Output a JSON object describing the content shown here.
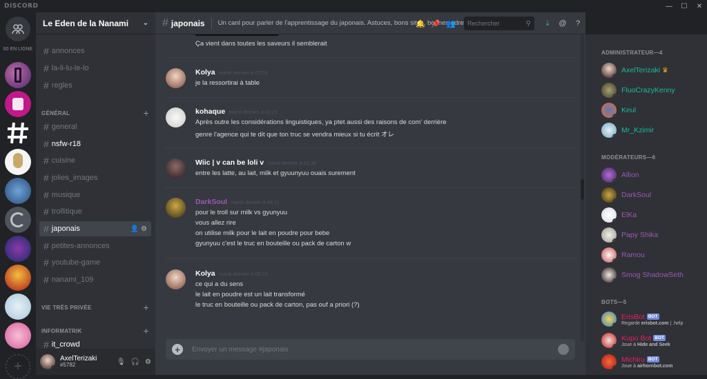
{
  "app": {
    "logo": "DISCORD",
    "win_minimize": "—",
    "win_maximize": "☐",
    "win_close": "✕"
  },
  "guilds": {
    "online_label": "60 EN LIGNE",
    "add_label": "+"
  },
  "server": {
    "name": "Le Eden de la Nanami",
    "chevron": "⌄"
  },
  "channels": [
    {
      "name": "annonces",
      "unread": false
    },
    {
      "name": "la-li-lu-le-lo",
      "unread": false
    },
    {
      "name": "regles",
      "unread": false
    }
  ],
  "categories": [
    {
      "label": "GÉNÉRAL",
      "plus": "+"
    },
    {
      "label": "VIE TRÈS PRIVÉE",
      "plus": "+"
    },
    {
      "label": "INFORMATRIK",
      "plus": "+"
    }
  ],
  "general_channels": [
    {
      "name": "general"
    },
    {
      "name": "nsfw-r18"
    },
    {
      "name": "cuisine"
    },
    {
      "name": "jolies_images"
    },
    {
      "name": "musique"
    },
    {
      "name": "trollitique"
    },
    {
      "name": "japonais"
    },
    {
      "name": "petites-annonces"
    },
    {
      "name": "youtube-game"
    },
    {
      "name": "nanami_109"
    }
  ],
  "info_channels": [
    {
      "name": "it_crowd"
    }
  ],
  "user": {
    "name": "AxelTerizaki",
    "tag": "#5782"
  },
  "header": {
    "channel": "japonais",
    "topic": "Un canl pour parler de l'apprentissage du japonais. Astuces, bons sites, bonnes adresses, ou appels à l...",
    "search_placeholder": "Rechercher"
  },
  "messages": {
    "top_line": "Ça vient dans toutes les saveurs il semblerait",
    "groups": [
      {
        "author": "Kolya",
        "time": "mardi dernier à 02:04",
        "color": "#ffffff",
        "lines": [
          "je la ressortirai à table"
        ]
      },
      {
        "author": "kohaque",
        "time": "mardi dernier à 02:21",
        "color": "#ffffff",
        "lines": [
          "Après outre les considérations linguistiques, ya ptet aussi des raisons de com' derrière",
          "genre l'agence qui te dit que ton truc se vendra mieux si tu écrit オレ"
        ]
      },
      {
        "author": "Wiic | v can be loli v",
        "time": "mardi dernier à 02:36",
        "color": "#ffffff",
        "lines": [
          "entre les latte, au lait, milk et gyuunyuu ouais surement"
        ]
      },
      {
        "author": "DarkSoul",
        "time": "mardi dernier à 08:11",
        "color": "#9b59b6",
        "lines": [
          "pour le troll sur milk vs gyunyuu",
          "vous allez rire",
          "on utilise milk pour le lait en poudre pour bebe",
          "gyunyuu c'est le truc en bouteille ou pack de carton w"
        ]
      },
      {
        "author": "Kolya",
        "time": "mardi dernier à 09:29",
        "color": "#ffffff",
        "lines": [
          "ce qui a du sens",
          "le lait en poudre est un lait transformé",
          "le truc en bouteille ou pack de carton, pas ouf a priori (?)"
        ]
      }
    ]
  },
  "composer": {
    "placeholder": "Envoyer un message #japonais"
  },
  "members": {
    "admin_label": "ADMINISTRATEUR—4",
    "mod_label": "MODÉRATEURS—6",
    "bots_label": "BOTS—5",
    "admins": [
      {
        "name": "AxelTerizaki",
        "color": "#1abc9c",
        "status": "#43b581",
        "crown": "♛"
      },
      {
        "name": "FluoCrazyKenny",
        "color": "#1abc9c",
        "status": "#faa61a"
      },
      {
        "name": "Keul",
        "color": "#1abc9c",
        "status": "#faa61a"
      },
      {
        "name": "Mr_Kzimir",
        "color": "#1abc9c",
        "status": "#faa61a"
      }
    ],
    "mods": [
      {
        "name": "Allion",
        "color": "#9b59b6",
        "status": "#faa61a"
      },
      {
        "name": "DarkSoul",
        "color": "#9b59b6",
        "status": "#43b581"
      },
      {
        "name": "ElKa",
        "color": "#9b59b6",
        "status": "#43b581"
      },
      {
        "name": "Papy Shika",
        "color": "#9b59b6",
        "status": "#faa61a"
      },
      {
        "name": "Ramou",
        "color": "#9b59b6",
        "status": "#faa61a"
      },
      {
        "name": "Smog ShadowSeth",
        "color": "#9b59b6",
        "status": "#f04747"
      }
    ],
    "bots": [
      {
        "name": "ErisBot",
        "color": "#e91e63",
        "status": "#43b581",
        "badge": "BOT",
        "sub_prefix": "Regarde ",
        "sub_bold": "erisbot.com",
        "sub_suffix": " | .help"
      },
      {
        "name": "Kupo Bot",
        "color": "#e91e63",
        "status": "#43b581",
        "badge": "BOT",
        "sub_prefix": "Joue à ",
        "sub_bold": "Hide and Seek",
        "sub_suffix": ""
      },
      {
        "name": "Michiru",
        "color": "#e91e63",
        "status": "#43b581",
        "badge": "BOT",
        "sub_prefix": "Joue à ",
        "sub_bold": "airhornbot.com",
        "sub_suffix": ""
      }
    ]
  }
}
